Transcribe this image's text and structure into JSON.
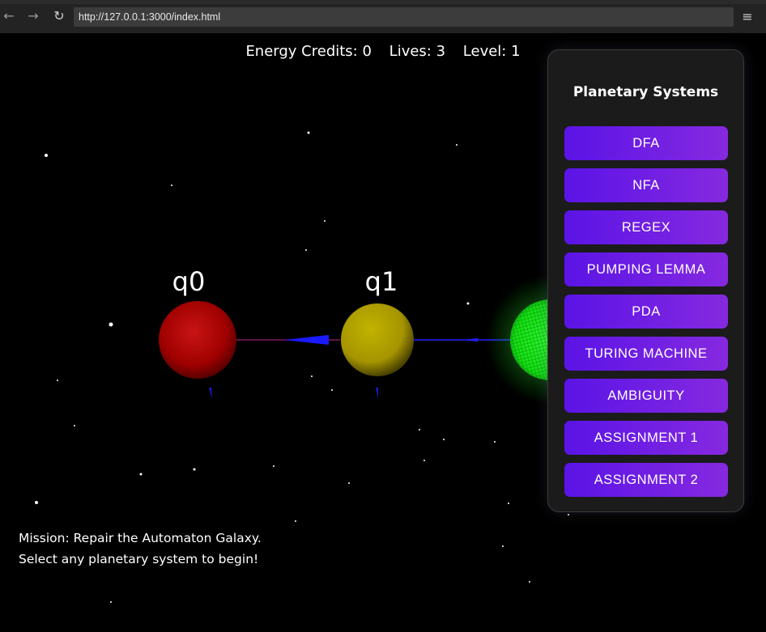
{
  "browser": {
    "url": "http://127.0.0.1:3000/index.html",
    "back_icon": "←",
    "forward_icon": "→",
    "reload_icon": "↻",
    "menu_icon": "≡"
  },
  "hud": {
    "energy": "Energy Credits: 0",
    "lives": "Lives: 3",
    "level": "Level: 1"
  },
  "states": [
    {
      "label": "q0",
      "color": "#b30000"
    },
    {
      "label": "q1",
      "color": "#b5a600"
    },
    {
      "label": "",
      "color": "#1aff1a"
    }
  ],
  "panel": {
    "title": "Planetary Systems",
    "buttons": [
      "DFA",
      "NFA",
      "REGEX",
      "PUMPING LEMMA",
      "PDA",
      "TURING MACHINE",
      "AMBIGUITY",
      "ASSIGNMENT 1",
      "ASSIGNMENT 2"
    ]
  },
  "mission": "Mission: Repair the Automaton Galaxy. Select any planetary system to begin!",
  "colors": {
    "button_start": "#5a14e6",
    "button_end": "#8629e0",
    "panel_bg": "#1b1b1b",
    "transition": "#0000ff"
  }
}
